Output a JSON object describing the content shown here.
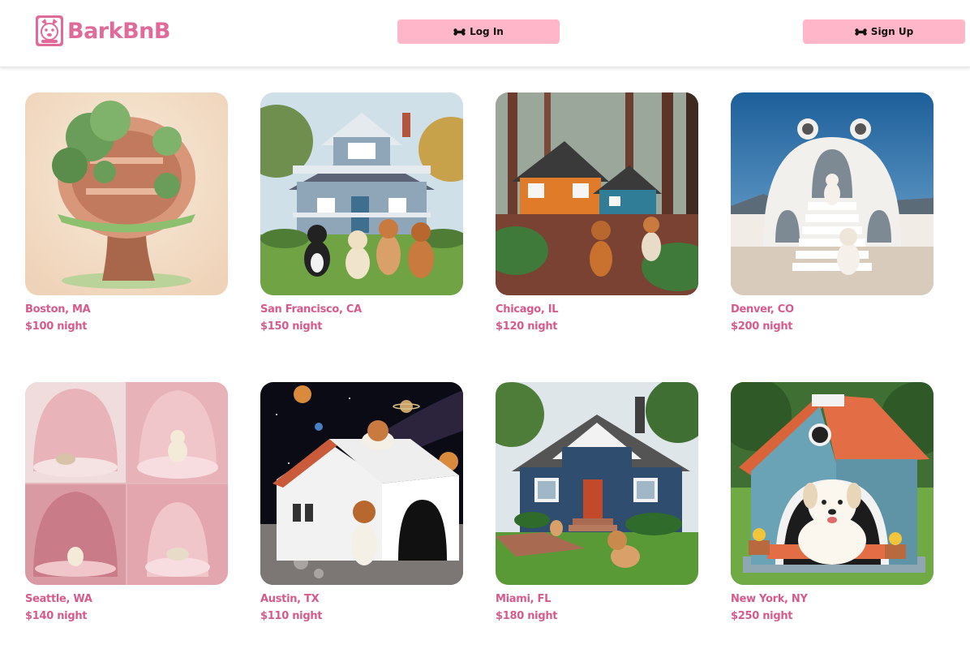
{
  "brand": {
    "name": "BarkBnB",
    "color": "#e06b9a"
  },
  "header": {
    "login_label": "Log In",
    "signup_label": "Sign Up",
    "button_color": "#ffb6c8"
  },
  "listings": [
    {
      "location": "Boston, MA",
      "price": "$100 night",
      "image": "treehouse"
    },
    {
      "location": "San Francisco, CA",
      "price": "$150 night",
      "image": "victorian-house-with-dogs"
    },
    {
      "location": "Chicago, IL",
      "price": "$120 night",
      "image": "forest-cabins"
    },
    {
      "location": "Denver, CO",
      "price": "$200 night",
      "image": "dome-house"
    },
    {
      "location": "Seattle, WA",
      "price": "$140 night",
      "image": "pink-canopy-beds"
    },
    {
      "location": "Austin, TX",
      "price": "$110 night",
      "image": "space-doghouse"
    },
    {
      "location": "Miami, FL",
      "price": "$180 night",
      "image": "blue-craftsman-house"
    },
    {
      "location": "New York, NY",
      "price": "$250 night",
      "image": "blue-doghouse"
    }
  ]
}
